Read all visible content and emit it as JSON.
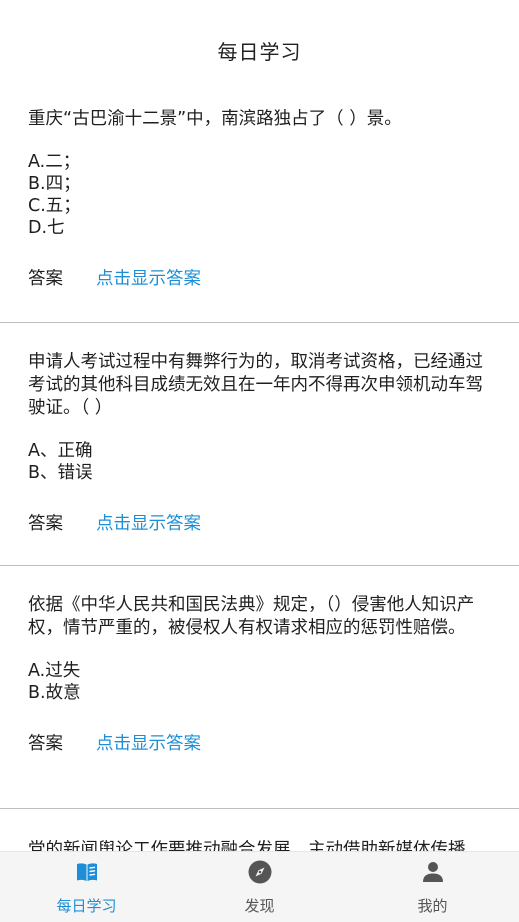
{
  "header": {
    "title": "每日学习"
  },
  "questions": [
    {
      "text": "重庆“古巴渝十二景”中，南滨路独占了（ ）景。",
      "options": [
        "A.二；",
        "B.四；",
        "C.五；",
        "D.七"
      ],
      "answer_label": "答案",
      "answer_link": "点击显示答案"
    },
    {
      "text": "申请人考试过程中有舞弊行为的，取消考试资格，已经通过考试的其他科目成绩无效且在一年内不得再次申领机动车驾驶证。（ ）",
      "options": [
        "A、正确",
        "B、错误"
      ],
      "answer_label": "答案",
      "answer_link": "点击显示答案"
    },
    {
      "text": "依据《中华人民共和国民法典》规定，（）侵害他人知识产权，情节严重的，被侵权人有权请求相应的惩罚性赔偿。",
      "options": [
        "A.过失",
        "B.故意"
      ],
      "answer_label": "答案",
      "answer_link": "点击显示答案"
    },
    {
      "text": "党的新闻舆论工作要推动融合发展，主动借助新媒体传播"
    }
  ],
  "tabbar": {
    "tabs": [
      {
        "label": "每日学习",
        "icon": "book-icon",
        "active": true
      },
      {
        "label": "发现",
        "icon": "compass-icon",
        "active": false
      },
      {
        "label": "我的",
        "icon": "person-icon",
        "active": false
      }
    ],
    "active_color": "#1e8fd6",
    "inactive_color": "#555555"
  }
}
